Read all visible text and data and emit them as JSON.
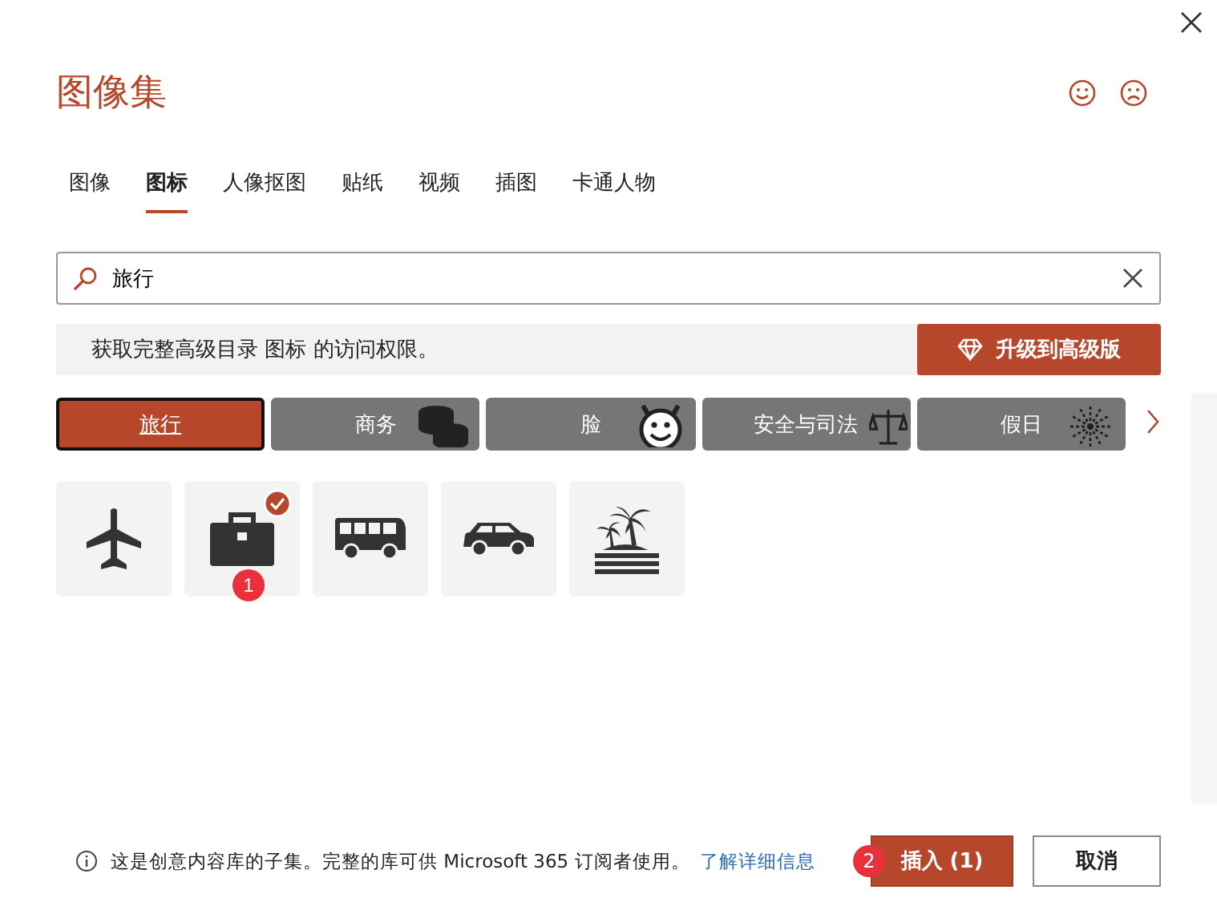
{
  "dialog": {
    "title": "图像集"
  },
  "tabs": [
    {
      "label": "图像",
      "selected": false
    },
    {
      "label": "图标",
      "selected": true
    },
    {
      "label": "人像抠图",
      "selected": false
    },
    {
      "label": "贴纸",
      "selected": false
    },
    {
      "label": "视频",
      "selected": false
    },
    {
      "label": "插图",
      "selected": false
    },
    {
      "label": "卡通人物",
      "selected": false
    }
  ],
  "search": {
    "value": "旅行"
  },
  "banner": {
    "text": "获取完整高级目录 图标 的访问权限。",
    "button": "升级到高级版"
  },
  "categories": [
    {
      "label": "旅行",
      "selected": true,
      "kind": "none"
    },
    {
      "label": "商务",
      "selected": false,
      "kind": "coins"
    },
    {
      "label": "脸",
      "selected": false,
      "kind": "face"
    },
    {
      "label": "安全与司法",
      "selected": false,
      "kind": "scales"
    },
    {
      "label": "假日",
      "selected": false,
      "kind": "fireworks"
    }
  ],
  "results": [
    {
      "kind": "airplane",
      "selected": false
    },
    {
      "kind": "briefcase",
      "selected": true,
      "order": "1"
    },
    {
      "kind": "bus",
      "selected": false
    },
    {
      "kind": "car",
      "selected": false
    },
    {
      "kind": "island",
      "selected": false
    }
  ],
  "footer": {
    "info": "这是创意内容库的子集。完整的库可供 Microsoft 365 订阅者使用。",
    "link": "了解详细信息",
    "insert": {
      "label": "插入 (1)",
      "step": "2"
    },
    "cancel": "取消"
  }
}
